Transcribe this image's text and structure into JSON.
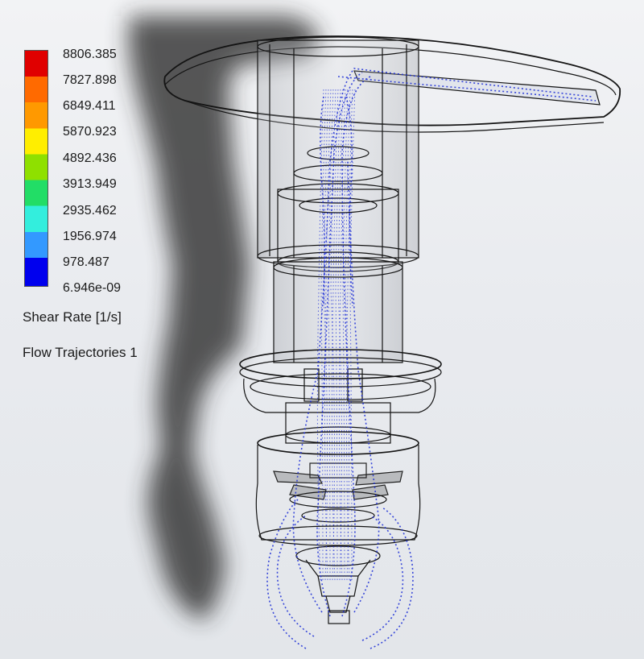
{
  "legend": {
    "ticks": [
      "8806.385",
      "7827.898",
      "6849.411",
      "5870.923",
      "4892.436",
      "3913.949",
      "2935.462",
      "1956.974",
      "978.487",
      "6.946e-09"
    ],
    "quantity_label": "Shear Rate [1/s]",
    "trajectory_label": "Flow Trajectories 1",
    "colors": [
      "#e00000",
      "#ff6a00",
      "#ff9900",
      "#ffee00",
      "#8fe000",
      "#22dd66",
      "#33eedd",
      "#3399ff",
      "#0000ee"
    ]
  },
  "colors": {
    "background": "#eceef1",
    "model_edges": "#111111",
    "trajectories": "#1a2bd6",
    "shadow": "#2a2a2a"
  }
}
